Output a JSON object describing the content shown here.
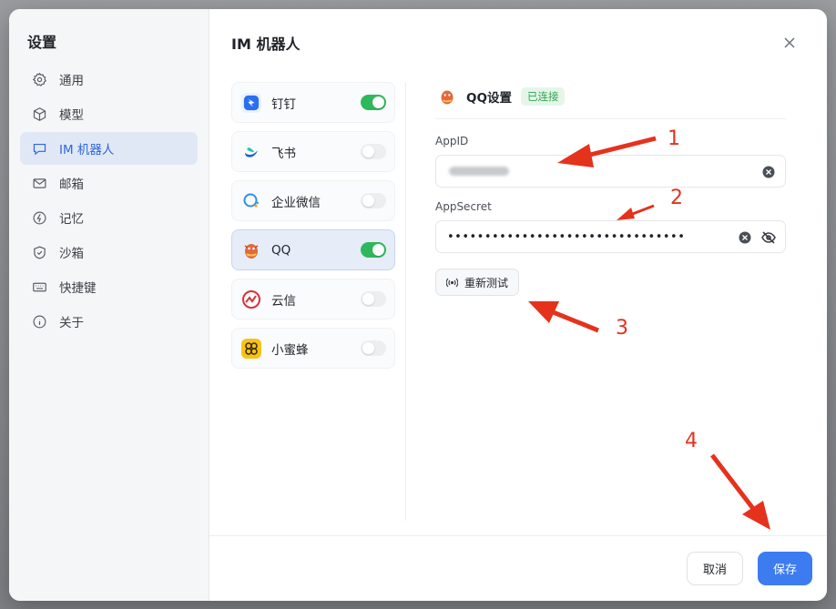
{
  "sidebar": {
    "title": "设置",
    "items": [
      {
        "label": "通用",
        "icon": "gear-icon"
      },
      {
        "label": "模型",
        "icon": "cube-icon"
      },
      {
        "label": "IM 机器人",
        "icon": "chat-icon"
      },
      {
        "label": "邮箱",
        "icon": "mail-icon"
      },
      {
        "label": "记忆",
        "icon": "memory-icon"
      },
      {
        "label": "沙箱",
        "icon": "shield-icon"
      },
      {
        "label": "快捷键",
        "icon": "keyboard-icon"
      },
      {
        "label": "关于",
        "icon": "info-icon"
      }
    ]
  },
  "main": {
    "title": "IM 机器人"
  },
  "im_list": [
    {
      "name": "钉钉",
      "enabled": true
    },
    {
      "name": "飞书",
      "enabled": false
    },
    {
      "name": "企业微信",
      "enabled": false
    },
    {
      "name": "QQ",
      "enabled": true
    },
    {
      "name": "云信",
      "enabled": false
    },
    {
      "name": "小蜜蜂",
      "enabled": false
    }
  ],
  "panel": {
    "title": "QQ设置",
    "status": "已连接",
    "appid_label": "AppID",
    "appsecret_label": "AppSecret",
    "appsecret_value": "••••••••••••••••••••••••••••••••",
    "retest_label": "重新测试"
  },
  "footer": {
    "cancel_label": "取消",
    "save_label": "保存"
  },
  "annotations": [
    "1",
    "2",
    "3",
    "4"
  ],
  "colors": {
    "accent": "#3d7bf0",
    "toggle_on": "#2eb85c",
    "annotation": "#e5321d"
  }
}
